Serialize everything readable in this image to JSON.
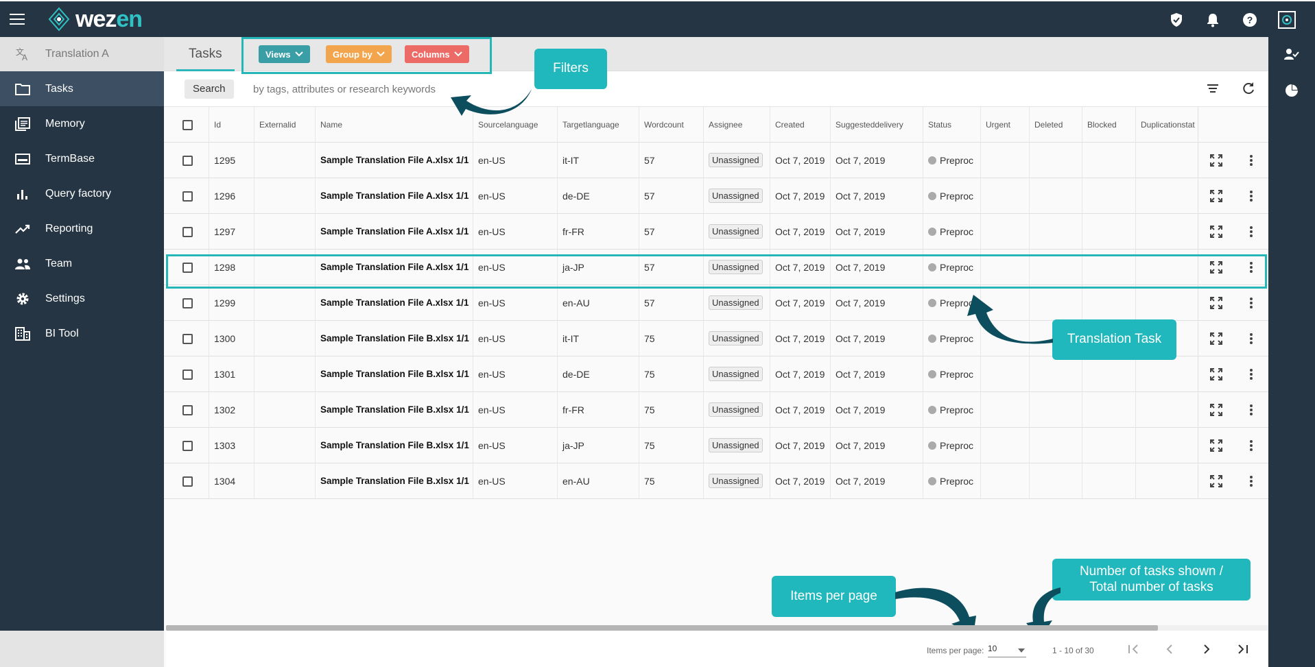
{
  "app": {
    "logo_text_a": "wez",
    "logo_text_b": "en",
    "accent": "#2fc1c4",
    "bg": "#253544"
  },
  "sidebar": {
    "app_name": "Translation A",
    "items": [
      {
        "label": "Tasks",
        "icon": "folder-icon",
        "active": true
      },
      {
        "label": "Memory",
        "icon": "memory-icon"
      },
      {
        "label": "TermBase",
        "icon": "termbase-icon"
      },
      {
        "label": "Query factory",
        "icon": "bar-chart-icon"
      },
      {
        "label": "Reporting",
        "icon": "trending-up-icon"
      },
      {
        "label": "Team",
        "icon": "team-icon"
      },
      {
        "label": "Settings",
        "icon": "gear-icon"
      },
      {
        "label": "BI Tool",
        "icon": "building-icon"
      }
    ]
  },
  "header": {
    "tab": "Tasks",
    "views": "Views",
    "group_by": "Group by",
    "columns": "Columns",
    "colors": {
      "views": "#3a9ea6",
      "group_by": "#f2a54d",
      "columns": "#ec6b66"
    }
  },
  "search": {
    "button": "Search",
    "placeholder": "by tags, attributes or research keywords"
  },
  "table": {
    "headers": [
      "Id",
      "Externalid",
      "Name",
      "Sourcelanguage",
      "Targetlanguage",
      "Wordcount",
      "Assignee",
      "Created",
      "Suggesteddelivery",
      "Status",
      "Urgent",
      "Deleted",
      "Blocked",
      "Duplicationstat"
    ],
    "rows": [
      [
        "1295",
        "",
        "Sample Translation File A.xlsx 1/1",
        "en-US",
        "it-IT",
        "57",
        "Unassigned",
        "Oct 7, 2019",
        "Oct 7, 2019",
        "Preproc"
      ],
      [
        "1296",
        "",
        "Sample Translation File A.xlsx 1/1",
        "en-US",
        "de-DE",
        "57",
        "Unassigned",
        "Oct 7, 2019",
        "Oct 7, 2019",
        "Preproc"
      ],
      [
        "1297",
        "",
        "Sample Translation File A.xlsx 1/1",
        "en-US",
        "fr-FR",
        "57",
        "Unassigned",
        "Oct 7, 2019",
        "Oct 7, 2019",
        "Preproc"
      ],
      [
        "1298",
        "",
        "Sample Translation File A.xlsx 1/1",
        "en-US",
        "ja-JP",
        "57",
        "Unassigned",
        "Oct 7, 2019",
        "Oct 7, 2019",
        "Preproc"
      ],
      [
        "1299",
        "",
        "Sample Translation File A.xlsx 1/1",
        "en-US",
        "en-AU",
        "57",
        "Unassigned",
        "Oct 7, 2019",
        "Oct 7, 2019",
        "Preproc"
      ],
      [
        "1300",
        "",
        "Sample Translation File B.xlsx 1/1",
        "en-US",
        "it-IT",
        "75",
        "Unassigned",
        "Oct 7, 2019",
        "Oct 7, 2019",
        "Preproc"
      ],
      [
        "1301",
        "",
        "Sample Translation File B.xlsx 1/1",
        "en-US",
        "de-DE",
        "75",
        "Unassigned",
        "Oct 7, 2019",
        "Oct 7, 2019",
        "Preproc"
      ],
      [
        "1302",
        "",
        "Sample Translation File B.xlsx 1/1",
        "en-US",
        "fr-FR",
        "75",
        "Unassigned",
        "Oct 7, 2019",
        "Oct 7, 2019",
        "Preproc"
      ],
      [
        "1303",
        "",
        "Sample Translation File B.xlsx 1/1",
        "en-US",
        "ja-JP",
        "75",
        "Unassigned",
        "Oct 7, 2019",
        "Oct 7, 2019",
        "Preproc"
      ],
      [
        "1304",
        "",
        "Sample Translation File B.xlsx 1/1",
        "en-US",
        "en-AU",
        "75",
        "Unassigned",
        "Oct 7, 2019",
        "Oct 7, 2019",
        "Preproc"
      ]
    ]
  },
  "pagination": {
    "items_per_page_label": "Items per page:",
    "items_per_page": "10",
    "range": "1 - 10 of 30"
  },
  "callouts": {
    "filters": "Filters",
    "translation_task": "Translation Task",
    "items_per_page": "Items per page",
    "tasks_shown_1": "Number of tasks shown /",
    "tasks_shown_2": "Total number of tasks"
  }
}
